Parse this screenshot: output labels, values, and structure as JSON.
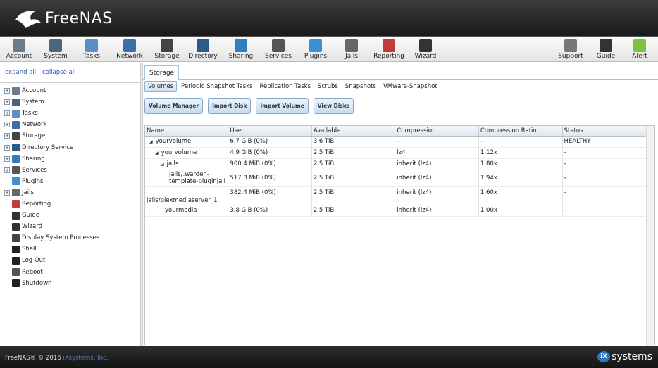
{
  "app": {
    "title": "FreeNAS"
  },
  "toolbar": {
    "items": [
      {
        "label": "Account",
        "icon": "account-icon",
        "color": "#6b7b8c"
      },
      {
        "label": "System",
        "icon": "system-icon",
        "color": "#4d6680"
      },
      {
        "label": "Tasks",
        "icon": "tasks-icon",
        "color": "#5a8ec4"
      },
      {
        "label": "Network",
        "icon": "network-icon",
        "color": "#3b6fa8"
      },
      {
        "label": "Storage",
        "icon": "storage-icon",
        "color": "#444444"
      },
      {
        "label": "Directory",
        "icon": "directory-icon",
        "color": "#2d5a8a"
      },
      {
        "label": "Sharing",
        "icon": "sharing-icon",
        "color": "#2f7fc0"
      },
      {
        "label": "Services",
        "icon": "services-icon",
        "color": "#555555"
      },
      {
        "label": "Plugins",
        "icon": "plugins-icon",
        "color": "#3c8fd0"
      },
      {
        "label": "Jails",
        "icon": "jails-icon",
        "color": "#666666"
      },
      {
        "label": "Reporting",
        "icon": "reporting-icon",
        "color": "#c23b3b"
      },
      {
        "label": "Wizard",
        "icon": "wizard-icon",
        "color": "#333333"
      },
      {
        "label": "Support",
        "icon": "support-icon",
        "color": "#777777"
      },
      {
        "label": "Guide",
        "icon": "guide-icon",
        "color": "#333333"
      },
      {
        "label": "Alert",
        "icon": "alert-icon",
        "color": "#7ec23a"
      }
    ]
  },
  "left": {
    "expand_all": "expand all",
    "collapse_all": "collapse all",
    "tree": [
      {
        "label": "Account",
        "expandable": true,
        "icon": "account-icon",
        "color": "#6b7b8c"
      },
      {
        "label": "System",
        "expandable": true,
        "icon": "system-icon",
        "color": "#4d6680"
      },
      {
        "label": "Tasks",
        "expandable": true,
        "icon": "tasks-icon",
        "color": "#5a8ec4"
      },
      {
        "label": "Network",
        "expandable": true,
        "icon": "network-icon",
        "color": "#3b6fa8"
      },
      {
        "label": "Storage",
        "expandable": true,
        "icon": "storage-icon",
        "color": "#444444"
      },
      {
        "label": "Directory Service",
        "expandable": true,
        "icon": "directory-icon",
        "color": "#2d5a8a"
      },
      {
        "label": "Sharing",
        "expandable": true,
        "icon": "sharing-icon",
        "color": "#2f7fc0"
      },
      {
        "label": "Services",
        "expandable": true,
        "icon": "services-icon",
        "color": "#555555"
      },
      {
        "label": "Plugins",
        "expandable": false,
        "icon": "plugins-icon",
        "color": "#3c8fd0"
      },
      {
        "label": "Jails",
        "expandable": true,
        "icon": "jails-icon",
        "color": "#666666"
      },
      {
        "label": "Reporting",
        "expandable": false,
        "icon": "reporting-icon",
        "color": "#c23b3b"
      },
      {
        "label": "Guide",
        "expandable": false,
        "icon": "guide-icon",
        "color": "#333333"
      },
      {
        "label": "Wizard",
        "expandable": false,
        "icon": "wizard-icon",
        "color": "#333333"
      },
      {
        "label": "Display System Processes",
        "expandable": false,
        "icon": "processes-icon",
        "color": "#444444"
      },
      {
        "label": "Shell",
        "expandable": false,
        "icon": "shell-icon",
        "color": "#222222"
      },
      {
        "label": "Log Out",
        "expandable": false,
        "icon": "logout-icon",
        "color": "#222222"
      },
      {
        "label": "Reboot",
        "expandable": false,
        "icon": "reboot-icon",
        "color": "#555555"
      },
      {
        "label": "Shutdown",
        "expandable": false,
        "icon": "shutdown-icon",
        "color": "#222222"
      }
    ]
  },
  "main": {
    "tab": "Storage",
    "subtabs": [
      "Volumes",
      "Periodic Snapshot Tasks",
      "Replication Tasks",
      "Scrubs",
      "Snapshots",
      "VMware-Snapshot"
    ],
    "active_subtab": "Volumes",
    "buttons": [
      "Volume Manager",
      "Import Disk",
      "Import Volume",
      "View Disks"
    ],
    "columns": [
      "Name",
      "Used",
      "Available",
      "Compression",
      "Compression Ratio",
      "Status"
    ],
    "rows": [
      {
        "name": "yourvolume",
        "indent": 0,
        "tri": true,
        "used": "6.7 GiB (0%)",
        "available": "3.6 TiB",
        "compression": "-",
        "ratio": "-",
        "status": "HEALTHY"
      },
      {
        "name": "yourvolume",
        "indent": 1,
        "tri": true,
        "used": "4.9 GiB (0%)",
        "available": "2.5 TiB",
        "compression": "lz4",
        "ratio": "1.12x",
        "status": "-"
      },
      {
        "name": "jails",
        "indent": 2,
        "tri": true,
        "used": "900.4 MiB (0%)",
        "available": "2.5 TiB",
        "compression": "inherit (lz4)",
        "ratio": "1.80x",
        "status": "-"
      },
      {
        "name": "jails/.warden-template-pluginjail",
        "indent": 3,
        "tri": false,
        "used": "517.8 MiB (0%)",
        "available": "2.5 TiB",
        "compression": "inherit (lz4)",
        "ratio": "1.94x",
        "status": "-"
      },
      {
        "name": "jails/plexmediaserver_1",
        "indent": 4,
        "tri": false,
        "used": "382.4 MiB (0%)",
        "available": "2.5 TiB",
        "compression": "inherit (lz4)",
        "ratio": "1.60x",
        "status": "-"
      },
      {
        "name": "yourmedia",
        "indent": 3,
        "tri": false,
        "used": "3.8 GiB (0%)",
        "available": "2.5 TiB",
        "compression": "inherit (lz4)",
        "ratio": "1.00x",
        "status": "-"
      }
    ]
  },
  "footer": {
    "copyright": "FreeNAS® © 2016 ",
    "company_link": "iXsystems, Inc.",
    "brand_badge": "iX",
    "brand_text": "systems"
  }
}
